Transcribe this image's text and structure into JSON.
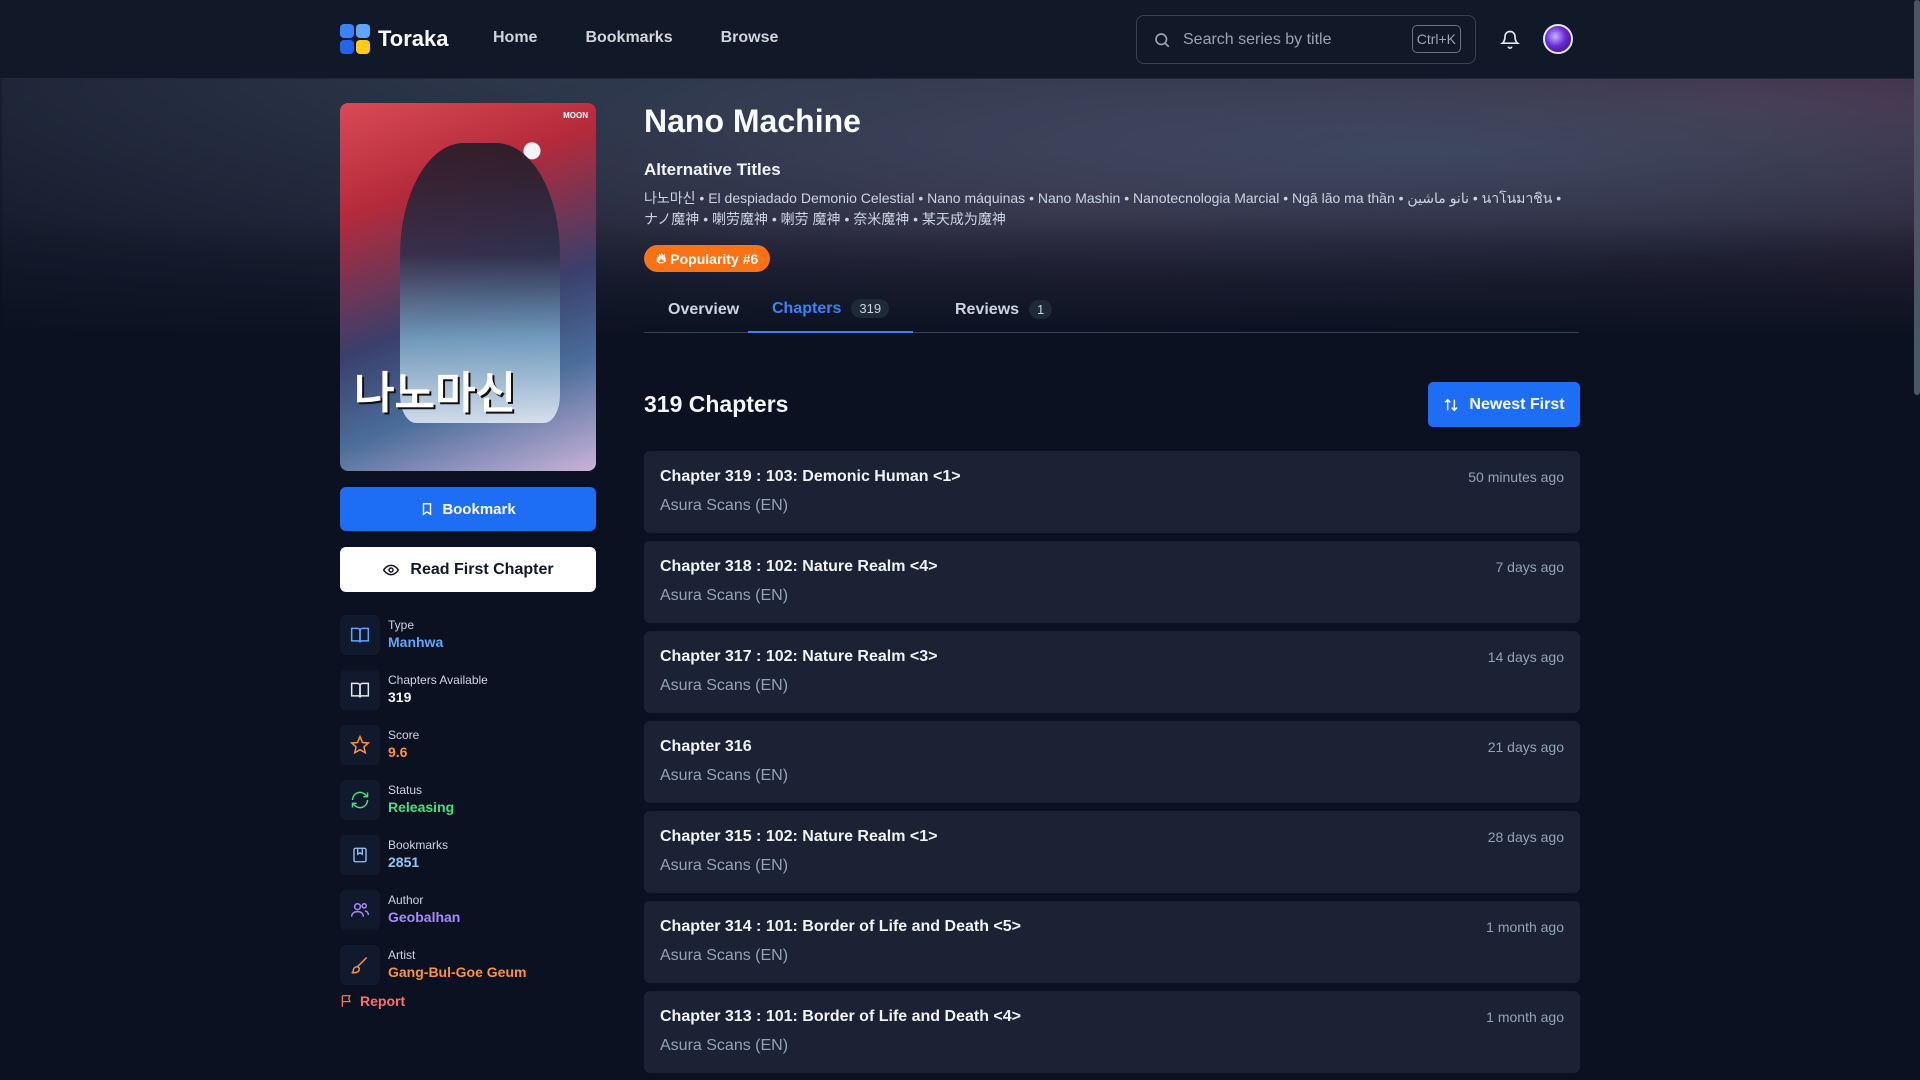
{
  "header": {
    "logo_text": "Toraka",
    "nav": [
      "Home",
      "Bookmarks",
      "Browse"
    ],
    "search_placeholder": "Search series by title",
    "search_shortcut": "Ctrl+K"
  },
  "series": {
    "title": "Nano Machine",
    "alt_heading": "Alternative Titles",
    "alt_titles": "나노마신 • El despiadado Demonio Celestial • Nano máquinas • Nano Mashin • Nanotecnologia Marcial • Ngã lão ma thần • نانو ماشين • นาโนมาชิน • ナノ魔神 • 喇劳魔神 • 喇劳 魔神 • 奈米魔神 • 某天成为魔神",
    "popularity": "Popularity #6",
    "cover_title": "나노마신",
    "cover_badge": "MOON"
  },
  "actions": {
    "bookmark": "Bookmark",
    "read_first": "Read First Chapter",
    "report": "Report"
  },
  "meta": [
    {
      "label": "Type",
      "value": "Manhwa",
      "color": "#60a5fa",
      "icon": "book-open-icon"
    },
    {
      "label": "Chapters Available",
      "value": "319",
      "color": "#f1f5f9",
      "icon": "book-icon"
    },
    {
      "label": "Score",
      "value": "9.6",
      "color": "#fb923c",
      "icon": "star-icon"
    },
    {
      "label": "Status",
      "value": "Releasing",
      "color": "#4ade80",
      "icon": "refresh-icon"
    },
    {
      "label": "Bookmarks",
      "value": "2851",
      "color": "#93c5fd",
      "icon": "bookmark-book-icon"
    },
    {
      "label": "Author",
      "value": "Geobalhan",
      "color": "#a78bfa",
      "icon": "users-icon"
    },
    {
      "label": "Artist",
      "value": "Gang-Bul-Goe Geum",
      "color": "#fb923c",
      "icon": "brush-icon"
    }
  ],
  "tabs": [
    {
      "label": "Overview",
      "count": null
    },
    {
      "label": "Chapters",
      "count": "319"
    },
    {
      "label": "Reviews",
      "count": "1"
    }
  ],
  "chapters_section": {
    "heading": "319 Chapters",
    "sort_label": "Newest First"
  },
  "chapters": [
    {
      "title": "Chapter 319 : 103: Demonic Human <1>",
      "group": "Asura Scans (EN)",
      "time": "50 minutes ago"
    },
    {
      "title": "Chapter 318 : 102: Nature Realm <4>",
      "group": "Asura Scans (EN)",
      "time": "7 days ago"
    },
    {
      "title": "Chapter 317 : 102: Nature Realm <3>",
      "group": "Asura Scans (EN)",
      "time": "14 days ago"
    },
    {
      "title": "Chapter 316",
      "group": "Asura Scans (EN)",
      "time": "21 days ago"
    },
    {
      "title": "Chapter 315 : 102: Nature Realm <1>",
      "group": "Asura Scans (EN)",
      "time": "28 days ago"
    },
    {
      "title": "Chapter 314 : 101: Border of Life and Death <5>",
      "group": "Asura Scans (EN)",
      "time": "1 month ago"
    },
    {
      "title": "Chapter 313 : 101: Border of Life and Death <4>",
      "group": "Asura Scans (EN)",
      "time": "1 month ago"
    }
  ],
  "colors": {
    "accent": "#1d6ef5",
    "popularity": "#f97316",
    "background": "#0b1120",
    "card": "#1a2233"
  }
}
